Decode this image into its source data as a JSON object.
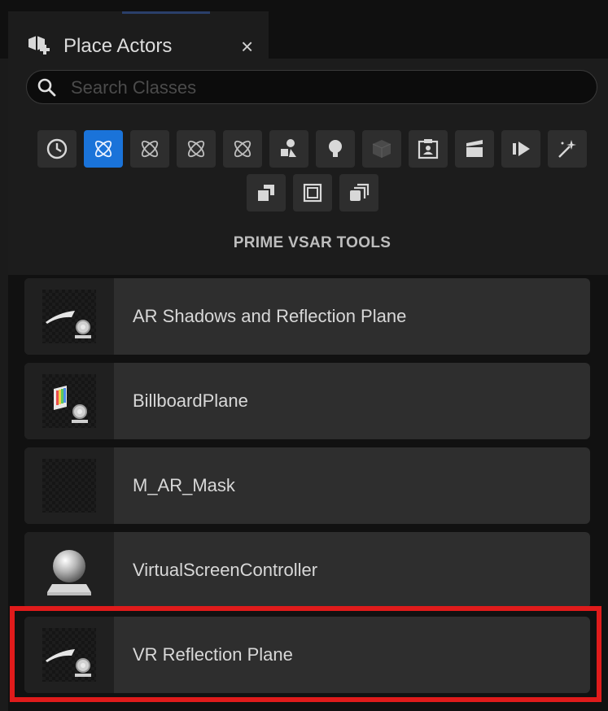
{
  "tab": {
    "title": "Place Actors",
    "close_glyph": "×",
    "icon": "place-actors-icon"
  },
  "search": {
    "placeholder": "Search Classes",
    "value": ""
  },
  "categories": [
    {
      "name": "recently-placed",
      "icon": "clock-icon",
      "active": false
    },
    {
      "name": "prime-vsar-tools",
      "icon": "atom-icon",
      "active": true
    },
    {
      "name": "category-3",
      "icon": "atom-icon",
      "active": false
    },
    {
      "name": "category-4",
      "icon": "atom-icon",
      "active": false
    },
    {
      "name": "category-5",
      "icon": "atom-icon",
      "active": false
    },
    {
      "name": "basic",
      "icon": "shapes-icon",
      "active": false
    },
    {
      "name": "lights",
      "icon": "lightbulb-icon",
      "active": false
    },
    {
      "name": "shapes",
      "icon": "cube-icon",
      "active": false
    },
    {
      "name": "cinematic",
      "icon": "portrait-icon",
      "active": false
    },
    {
      "name": "visual-effects",
      "icon": "clapperboard-icon",
      "active": false
    },
    {
      "name": "media",
      "icon": "media-play-icon",
      "active": false
    },
    {
      "name": "effects",
      "icon": "sparkle-icon",
      "active": false
    },
    {
      "name": "volumes",
      "icon": "volumes-icon",
      "active": false
    },
    {
      "name": "all-classes",
      "icon": "layers-icon",
      "active": false
    },
    {
      "name": "geometry",
      "icon": "stacked-cubes-icon",
      "active": false
    }
  ],
  "section_title": "PRIME VSAR TOOLS",
  "items": [
    {
      "label": "AR Shadows and Reflection Plane",
      "thumb": "camera-plane-icon"
    },
    {
      "label": "BillboardPlane",
      "thumb": "billboard-icon"
    },
    {
      "label": "M_AR_Mask",
      "thumb": "checker-icon"
    },
    {
      "label": "VirtualScreenController",
      "thumb": "sphere-icon"
    },
    {
      "label": "VR Reflection Plane",
      "thumb": "camera-plane-icon"
    }
  ],
  "colors": {
    "accent": "#1a73d9",
    "highlight": "#e01b1b",
    "background": "#1c1c1c"
  }
}
